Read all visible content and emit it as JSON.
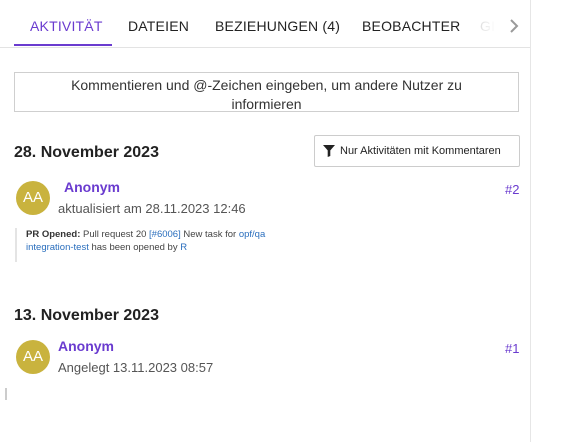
{
  "tabs": [
    {
      "label": "AKTIVITÄT",
      "active": true
    },
    {
      "label": "DATEIEN"
    },
    {
      "label": "BEZIEHUNGEN (4)"
    },
    {
      "label": "BEOBACHTER"
    },
    {
      "label": "GI"
    }
  ],
  "tab_scroll_icon": "chevron-right-icon",
  "comment_box": {
    "placeholder": "Kommentieren und @-Zeichen eingeben, um andere Nutzer zu informieren"
  },
  "filter_button": {
    "icon": "filter-icon",
    "label": "Nur Aktivitäten mit Kommentaren"
  },
  "days": [
    {
      "heading": "28. November 2023",
      "entry": {
        "avatar_initials": "AA",
        "author": "Anonym",
        "meta": "aktualisiert am 28.11.2023 12:46",
        "number": "#2",
        "details": {
          "prefix": "PR Opened:",
          "text_1": "Pull request 20",
          "link_1": "[#6006]",
          "text_2": "New task for",
          "link_2": "opf/qa integration-test",
          "text_3": "has been opened by",
          "link_3": "R"
        }
      }
    },
    {
      "heading": "13. November 2023",
      "entry": {
        "avatar_initials": "AA",
        "author": "Anonym",
        "meta": "Angelegt 13.11.2023 08:57",
        "number": "#1"
      }
    }
  ],
  "colors": {
    "accent": "#6a3bcf",
    "avatar": "#c9b33e",
    "link": "#2a6ebd"
  }
}
